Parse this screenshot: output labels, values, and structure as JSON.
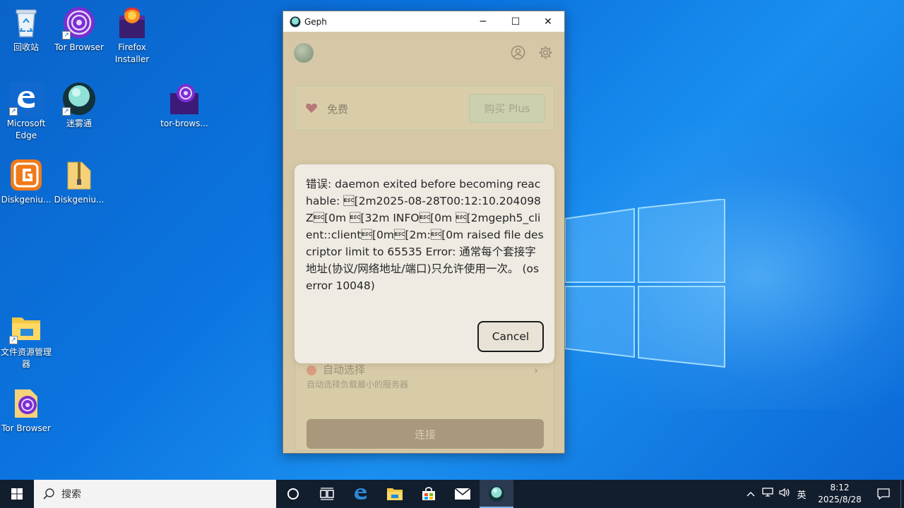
{
  "desktop": {
    "icons": [
      {
        "label": "回收站"
      },
      {
        "label": "Tor Browser"
      },
      {
        "label": "Firefox Installer"
      },
      {
        "label": "Microsoft Edge"
      },
      {
        "label": "迷雾通"
      },
      {
        "label": "tor-brows..."
      },
      {
        "label": "Diskgeniu..."
      },
      {
        "label": "Diskgeniu..."
      },
      {
        "label": "文件资源管理器"
      },
      {
        "label": "Tor Browser"
      }
    ]
  },
  "window": {
    "title": "Geph",
    "controls": {
      "minimize": "─",
      "maximize": "☐",
      "close": "✕"
    }
  },
  "app": {
    "plan": {
      "label": "免费",
      "buy_label": "购买 Plus"
    },
    "server": {
      "title": "自动选择",
      "subtitle": "自动选择负载最小的服务器",
      "chevron": "›"
    },
    "connect_label": "连接",
    "dialog": {
      "message": "错误: daemon exited before becoming reachable: \u001b[2m2025-08-28T00:12:10.204098Z\u001b[0m \u001b[32m INFO\u001b[0m \u001b[2mgeph5_client::client\u001b[0m\u001b[2m:\u001b[0m raised file descriptor limit to 65535 Error: 通常每个套接字地址(协议/网络地址/端口)只允许使用一次。 (os error 10048)",
      "cancel_label": "Cancel"
    }
  },
  "taskbar": {
    "search_placeholder": "搜索",
    "tray": {
      "ime": "英"
    },
    "clock": {
      "time": "8:12",
      "date": "2025/8/28"
    }
  },
  "colors": {
    "app_background": "#d6c8a6",
    "dialog_background": "#efebe3",
    "taskbar": "#121d2d",
    "wallpaper": "#0b74df"
  }
}
